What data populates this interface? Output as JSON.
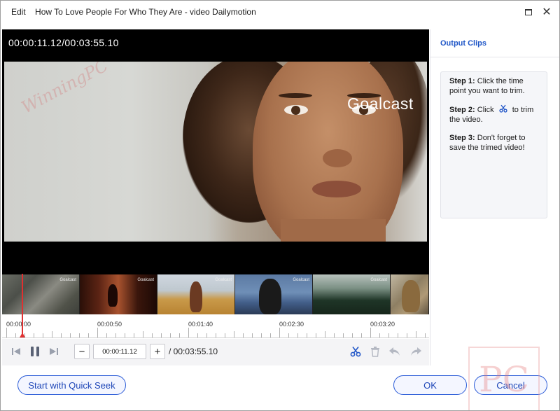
{
  "window": {
    "menu_label": "Edit",
    "title": "How To Love People For Who They Are - video Dailymotion"
  },
  "video": {
    "timecode": "00:00:11.12/00:03:55.10",
    "brand_overlay": "Goalcast",
    "watermark": "WinningPC"
  },
  "filmstrip": {
    "thumb_label": "Goalcast"
  },
  "ruler": {
    "labels": [
      "00:00:00",
      "00:00:50",
      "00:01:40",
      "00:02:30",
      "00:03:20"
    ]
  },
  "controls": {
    "minus_label": "−",
    "plus_label": "+",
    "current_time": "00:00:11.12",
    "total_time": "/ 00:03:55.10"
  },
  "panel": {
    "title": "Output Clips",
    "step1_label": "Step 1:",
    "step1_text": "Click the time point you want to trim.",
    "step2_label": "Step 2:",
    "step2_text_a": "Click",
    "step2_text_b": "to trim the video.",
    "step3_label": "Step 3:",
    "step3_text": "Don't forget to save the trimed video!"
  },
  "buttons": {
    "quick_seek": "Start with Quick Seek",
    "ok": "OK",
    "cancel": "Cancel"
  },
  "colors": {
    "accent": "#1f56c7",
    "playhead": "#e03030"
  }
}
